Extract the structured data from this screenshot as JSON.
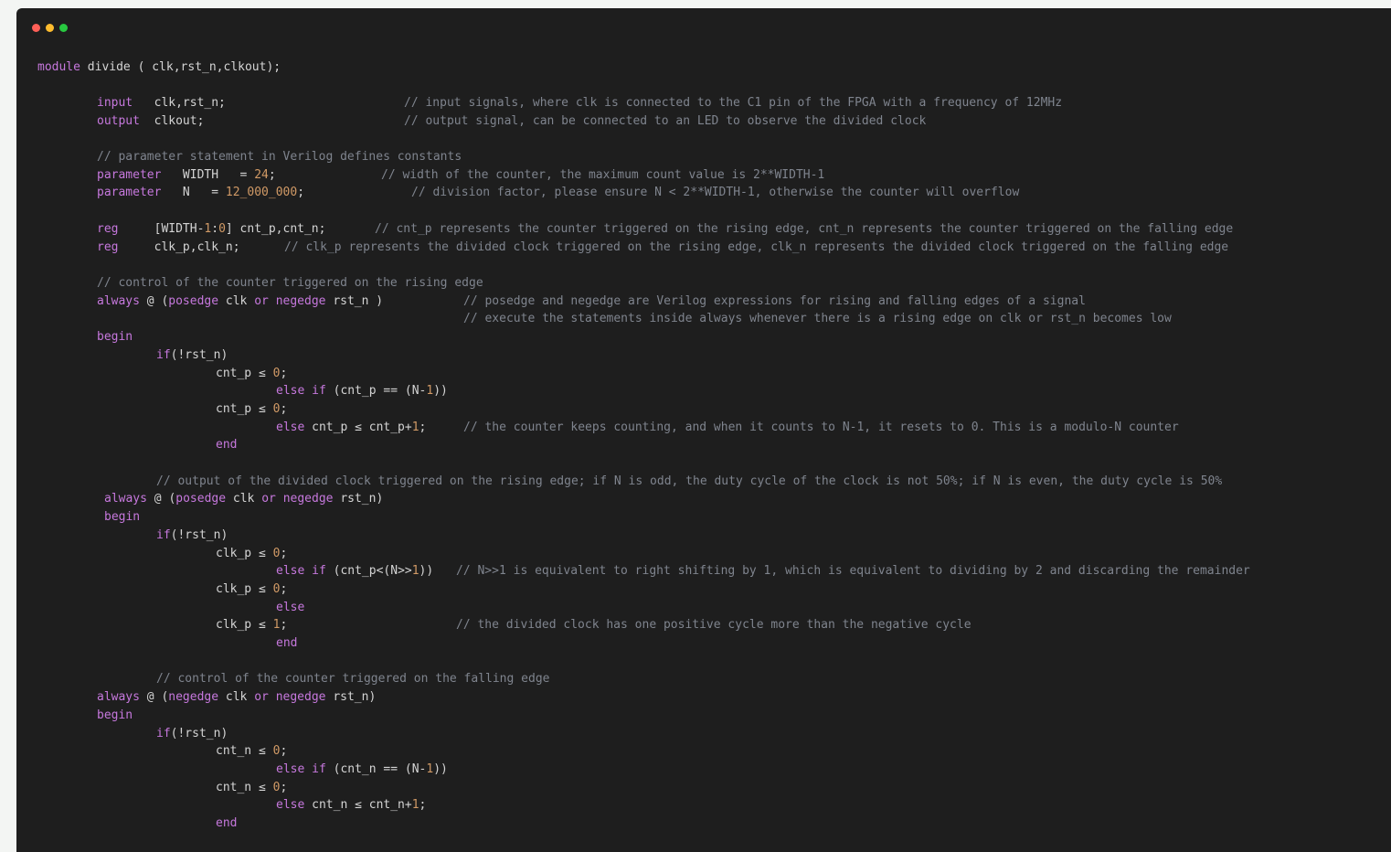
{
  "window": {
    "controls": [
      "close",
      "minimize",
      "maximize"
    ],
    "colors": {
      "background": "#1e1e1e",
      "keyword": "#c678dd",
      "number": "#d19a66",
      "comment": "#7f848e",
      "text": "#d4d4d4"
    }
  },
  "code": {
    "language": "verilog",
    "lines": [
      [
        {
          "t": "module",
          "c": "kw"
        },
        {
          "t": " divide ( clk,rst_n,clkout);",
          "c": "id"
        }
      ],
      [],
      [
        {
          "t": "input",
          "c": "kw"
        },
        {
          "t": "   clk,rst_n;",
          "c": "id"
        },
        {
          "t": "// input signals, where clk is connected to the C1 pin of the FPGA with a frequency of 12MHz",
          "c": "cm",
          "gap": 28
        }
      ],
      [
        {
          "t": "output",
          "c": "kw"
        },
        {
          "t": "  clkout;",
          "c": "id"
        },
        {
          "t": "// output signal, can be connected to an LED to observe the divided clock",
          "c": "cm",
          "gap": 28
        }
      ],
      [],
      [
        {
          "t": "// parameter statement in Verilog defines constants",
          "c": "cm"
        }
      ],
      [
        {
          "t": "parameter",
          "c": "kw"
        },
        {
          "t": "   WIDTH   = ",
          "c": "id"
        },
        {
          "t": "24",
          "c": "num"
        },
        {
          "t": ";",
          "c": "id"
        },
        {
          "t": "// width of the counter, the maximum count value is 2**WIDTH-1",
          "c": "cm",
          "gap": 25
        }
      ],
      [
        {
          "t": "parameter",
          "c": "kw"
        },
        {
          "t": "   N   = ",
          "c": "id"
        },
        {
          "t": "12_000_000",
          "c": "num"
        },
        {
          "t": ";",
          "c": "id"
        },
        {
          "t": "// division factor, please ensure N < 2**WIDTH-1, otherwise the counter will overflow",
          "c": "cm",
          "gap": 29
        }
      ],
      [],
      [
        {
          "t": "reg",
          "c": "kw"
        },
        {
          "t": "     [WIDTH-",
          "c": "id"
        },
        {
          "t": "1",
          "c": "num"
        },
        {
          "t": ":",
          "c": "id"
        },
        {
          "t": "0",
          "c": "num"
        },
        {
          "t": "] cnt_p,cnt_n;",
          "c": "id"
        },
        {
          "t": "// cnt_p represents the counter triggered on the rising edge, cnt_n represents the counter triggered on the falling edge",
          "c": "cm",
          "gap": 21
        }
      ],
      [
        {
          "t": "reg",
          "c": "kw"
        },
        {
          "t": "     clk_p,clk_n;",
          "c": "id"
        },
        {
          "t": "// clk_p represents the divided clock triggered on the rising edge, clk_n represents the divided clock triggered on the falling edge",
          "c": "cm",
          "gap": 9
        }
      ],
      [],
      [
        {
          "t": "// control of the counter triggered on the rising edge",
          "c": "cm"
        }
      ],
      [
        {
          "t": "always",
          "c": "kw"
        },
        {
          "t": " @ (",
          "c": "id"
        },
        {
          "t": "posedge",
          "c": "kw"
        },
        {
          "t": " clk ",
          "c": "id"
        },
        {
          "t": "or",
          "c": "kw"
        },
        {
          "t": " ",
          "c": "id"
        },
        {
          "t": "negedge",
          "c": "kw"
        },
        {
          "t": " rst_n )",
          "c": "id"
        },
        {
          "t": "// posedge and negedge are Verilog expressions for rising and falling edges of a signal",
          "c": "cm",
          "gap": 50
        }
      ],
      [
        {
          "t": "// execute the statements inside always whenever there is a rising edge on clk or rst_n becomes low",
          "c": "cm",
          "gap": 50
        }
      ],
      [
        {
          "t": "begin",
          "c": "kw"
        }
      ],
      [
        {
          "t": "if",
          "c": "kw"
        },
        {
          "t": "(!rst_n)",
          "c": "id"
        }
      ],
      [
        {
          "t": "cnt_p ≤ ",
          "c": "id"
        },
        {
          "t": "0",
          "c": "num"
        },
        {
          "t": ";",
          "c": "id"
        }
      ],
      [
        {
          "t": "else if",
          "c": "kw"
        },
        {
          "t": " (cnt_p == (N-",
          "c": "id"
        },
        {
          "t": "1",
          "c": "num"
        },
        {
          "t": "))",
          "c": "id"
        }
      ],
      [
        {
          "t": "cnt_p ≤ ",
          "c": "id"
        },
        {
          "t": "0",
          "c": "num"
        },
        {
          "t": ";",
          "c": "id"
        }
      ],
      [
        {
          "t": "else",
          "c": "kw"
        },
        {
          "t": " cnt_p ≤ cnt_p+",
          "c": "id"
        },
        {
          "t": "1",
          "c": "num"
        },
        {
          "t": ";",
          "c": "id"
        },
        {
          "t": "// the counter keeps counting, and when it counts to N-1, it resets to 0. This is a modulo-N counter",
          "c": "cm",
          "gap": 50
        }
      ],
      [
        {
          "t": "end",
          "c": "kw"
        }
      ],
      [],
      [
        {
          "t": "// output of the divided clock triggered on the rising edge; if N is odd, the duty cycle of the clock is not 50%; if N is even, the duty cycle is 50%",
          "c": "cm"
        }
      ],
      [
        {
          "t": "always",
          "c": "kw"
        },
        {
          "t": " @ (",
          "c": "id"
        },
        {
          "t": "posedge",
          "c": "kw"
        },
        {
          "t": " clk ",
          "c": "id"
        },
        {
          "t": "or",
          "c": "kw"
        },
        {
          "t": " ",
          "c": "id"
        },
        {
          "t": "negedge",
          "c": "kw"
        },
        {
          "t": " rst_n)",
          "c": "id"
        }
      ],
      [
        {
          "t": "begin",
          "c": "kw"
        }
      ],
      [
        {
          "t": "if",
          "c": "kw"
        },
        {
          "t": "(!rst_n)",
          "c": "id"
        }
      ],
      [
        {
          "t": "clk_p ≤ ",
          "c": "id"
        },
        {
          "t": "0",
          "c": "num"
        },
        {
          "t": ";",
          "c": "id"
        }
      ],
      [
        {
          "t": "else if",
          "c": "kw"
        },
        {
          "t": " (cnt_p<(N>>",
          "c": "id"
        },
        {
          "t": "1",
          "c": "num"
        },
        {
          "t": "))",
          "c": "id"
        },
        {
          "t": "// N>>1 is equivalent to right shifting by 1, which is equivalent to dividing by 2 and discarding the remainder",
          "c": "cm",
          "gap": 49
        }
      ],
      [
        {
          "t": "clk_p ≤ ",
          "c": "id"
        },
        {
          "t": "0",
          "c": "num"
        },
        {
          "t": ";",
          "c": "id"
        }
      ],
      [
        {
          "t": "else",
          "c": "kw"
        }
      ],
      [
        {
          "t": "clk_p ≤ ",
          "c": "id"
        },
        {
          "t": "1",
          "c": "num"
        },
        {
          "t": ";",
          "c": "id"
        },
        {
          "t": "// the divided clock has one positive cycle more than the negative cycle",
          "c": "cm",
          "gap": 49
        }
      ],
      [
        {
          "t": "end",
          "c": "kw"
        }
      ],
      [],
      [
        {
          "t": "// control of the counter triggered on the falling edge",
          "c": "cm"
        }
      ],
      [
        {
          "t": "always",
          "c": "kw"
        },
        {
          "t": " @ (",
          "c": "id"
        },
        {
          "t": "negedge",
          "c": "kw"
        },
        {
          "t": " clk ",
          "c": "id"
        },
        {
          "t": "or",
          "c": "kw"
        },
        {
          "t": " ",
          "c": "id"
        },
        {
          "t": "negedge",
          "c": "kw"
        },
        {
          "t": " rst_n)",
          "c": "id"
        }
      ],
      [
        {
          "t": "begin",
          "c": "kw"
        }
      ],
      [
        {
          "t": "if",
          "c": "kw"
        },
        {
          "t": "(!rst_n)",
          "c": "id"
        }
      ],
      [
        {
          "t": "cnt_n ≤ ",
          "c": "id"
        },
        {
          "t": "0",
          "c": "num"
        },
        {
          "t": ";",
          "c": "id"
        }
      ],
      [
        {
          "t": "else if",
          "c": "kw"
        },
        {
          "t": " (cnt_n == (N-",
          "c": "id"
        },
        {
          "t": "1",
          "c": "num"
        },
        {
          "t": "))",
          "c": "id"
        }
      ],
      [
        {
          "t": "cnt_n ≤ ",
          "c": "id"
        },
        {
          "t": "0",
          "c": "num"
        },
        {
          "t": ";",
          "c": "id"
        }
      ],
      [
        {
          "t": "else",
          "c": "kw"
        },
        {
          "t": " cnt_n ≤ cnt_n+",
          "c": "id"
        },
        {
          "t": "1",
          "c": "num"
        },
        {
          "t": ";",
          "c": "id"
        }
      ],
      [
        {
          "t": "end",
          "c": "kw"
        }
      ]
    ]
  }
}
